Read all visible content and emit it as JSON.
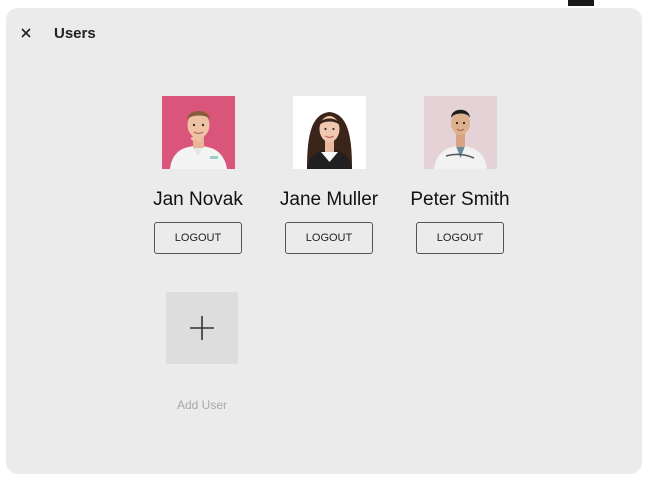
{
  "header": {
    "title": "Users",
    "close_icon": "close-icon"
  },
  "users": [
    {
      "name": "Jan Novak",
      "logout_label": "LOGOUT",
      "avatar_bg": "#d9567a"
    },
    {
      "name": "Jane Muller",
      "logout_label": "LOGOUT",
      "avatar_bg": "#ffffff"
    },
    {
      "name": "Peter Smith",
      "logout_label": "LOGOUT",
      "avatar_bg": "#e4d2d6"
    }
  ],
  "add_user": {
    "label": "Add User",
    "icon": "plus-icon"
  },
  "colors": {
    "panel_bg": "#ebebeb",
    "tile_bg": "#dddddd",
    "muted_text": "#a8a8a8"
  }
}
